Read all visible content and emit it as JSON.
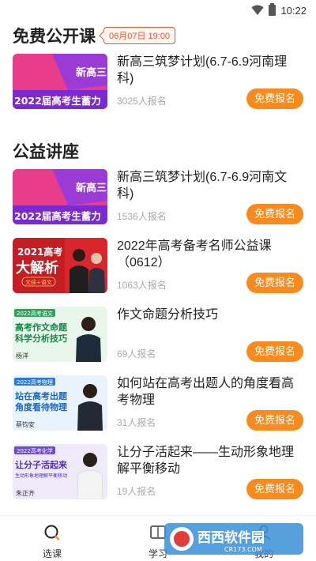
{
  "status_bar": {
    "time": "10:22"
  },
  "free_courses": {
    "title": "免费公开课",
    "date_badge": "06月07日 19:00",
    "items": [
      {
        "title": "新高三筑梦计划(6.7-6.9河南理科)",
        "count": "3025人报名",
        "button": "免费报名",
        "thumb": {
          "tag": "新高三",
          "line": "2022届高考生蓄力"
        }
      }
    ]
  },
  "lectures": {
    "title": "公益讲座",
    "items": [
      {
        "title": "新高三筑梦计划(6.7-6.9河南文科)",
        "count": "1536人报名",
        "button": "免费报名",
        "thumb": {
          "tag": "新高三",
          "line": "2022届高考生蓄力"
        }
      },
      {
        "title": "2022年高考备考名师公益课（0612）",
        "count": "1063人报名",
        "button": "免费报名",
        "thumb": {
          "tag": "2021高考",
          "line": "大解析",
          "sub": "文综+语文"
        }
      },
      {
        "title": "作文命题分析技巧",
        "count": "69人报名",
        "button": "免费报名",
        "thumb": {
          "tag": "2022高考语文",
          "line1": "高考作文命题",
          "line2": "科学分析技巧",
          "name": "杨洋"
        }
      },
      {
        "title": "如何站在高考出题人的角度看高考物理",
        "count": "31人报名",
        "button": "免费报名",
        "thumb": {
          "tag": "2022高考物理",
          "line1": "站在高考出题",
          "line2": "角度看待物理",
          "name": "蔡钧安"
        }
      },
      {
        "title": "让分子活起来——生动形象地理解平衡移动",
        "count": "19人报名",
        "button": "免费报名",
        "thumb": {
          "tag": "2022高考化学",
          "line1": "让分子活起来",
          "line2": "生动形象地理解平衡移动",
          "name": "朱正齐"
        }
      }
    ]
  },
  "bottom_nav": {
    "items": [
      {
        "label": "选课",
        "icon": "search-icon",
        "active": true
      },
      {
        "label": "学习",
        "icon": "book-icon",
        "active": false
      },
      {
        "label": "我的",
        "icon": "user-icon",
        "active": false
      }
    ]
  },
  "watermark": {
    "text": "西西软件园",
    "url": "CR173.COM"
  },
  "colors": {
    "accent": "#f98b1e",
    "badge": "#e4572e"
  }
}
